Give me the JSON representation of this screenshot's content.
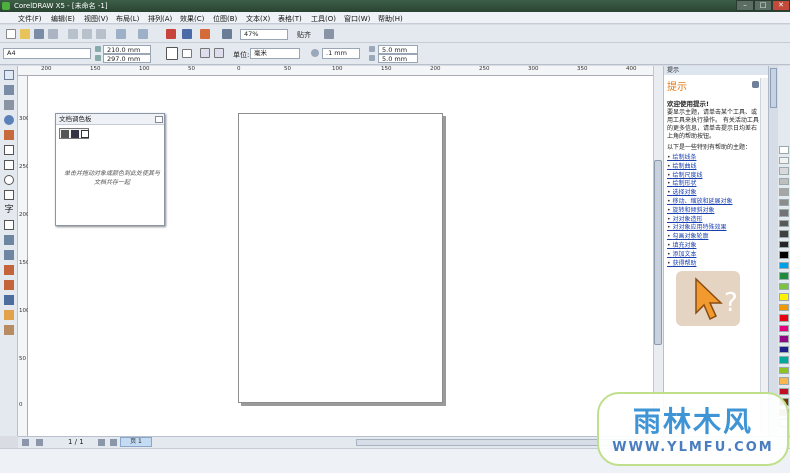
{
  "window": {
    "title": "CorelDRAW X5 - [未命名 -1]"
  },
  "menu": [
    "文件(F)",
    "编辑(E)",
    "视图(V)",
    "布局(L)",
    "排列(A)",
    "效果(C)",
    "位图(B)",
    "文本(X)",
    "表格(T)",
    "工具(O)",
    "窗口(W)",
    "帮助(H)"
  ],
  "toolbar": {
    "zoom": "47%",
    "snap": "贴齐"
  },
  "property_bar": {
    "paper_size": "A4",
    "width": "210.0 mm",
    "height": "297.0 mm",
    "units_label": "单位:",
    "units": "毫米",
    "nudge": ".1 mm",
    "dup_x": "5.0 mm",
    "dup_y": "5.0 mm"
  },
  "ruler_h": [
    "200",
    "150",
    "100",
    "50",
    "0",
    "50",
    "100",
    "150",
    "200",
    "250",
    "300",
    "350",
    "400"
  ],
  "ruler_v": [
    "300",
    "250",
    "200",
    "150",
    "100",
    "50",
    "0"
  ],
  "palette_docker": {
    "title": "文档调色板",
    "message": "单击并拖动对象或颜色到此处使其与文档共存一起"
  },
  "hints": {
    "tab": "提示",
    "heading": "提示",
    "welcome": "欢迎使用提示!",
    "para": "要显示主题，请单击某个工具、或用工具来执行操作。 有关活动工具的更多信息，请单击提示日均差右上角的帮助按钮。",
    "intro": "以下是一些特别有帮助的主题：",
    "topics": [
      "绘制线条",
      "绘制曲线",
      "绘制尺度线",
      "绘制形状",
      "选择对象",
      "移动、缩放和延展对象",
      "旋转和倾斜对象",
      "对对象造形",
      "对对象应用特殊效果",
      "勾画对象轮廓",
      "填充对象",
      "添加文本",
      "获得帮助"
    ]
  },
  "palette_colors": [
    "#ffffff",
    "#f2f2f2",
    "#d9d9d9",
    "#bfbfbf",
    "#a6a6a6",
    "#8c8c8c",
    "#737373",
    "#595959",
    "#404040",
    "#262626",
    "#000000",
    "#00a0e9",
    "#1e8c3c",
    "#7fc241",
    "#fff200",
    "#f39800",
    "#e60012",
    "#e4007f",
    "#920783",
    "#1d2088",
    "#00a99d",
    "#8fc31f",
    "#f8b551",
    "#c30d23",
    "#6a3906",
    "#b28850",
    "#ffffff"
  ],
  "status": {
    "page_label": "1 / 1",
    "page_tab": "页 1"
  },
  "watermark": {
    "brand": "雨林木风",
    "url": "WWW.YLMFU.COM"
  }
}
